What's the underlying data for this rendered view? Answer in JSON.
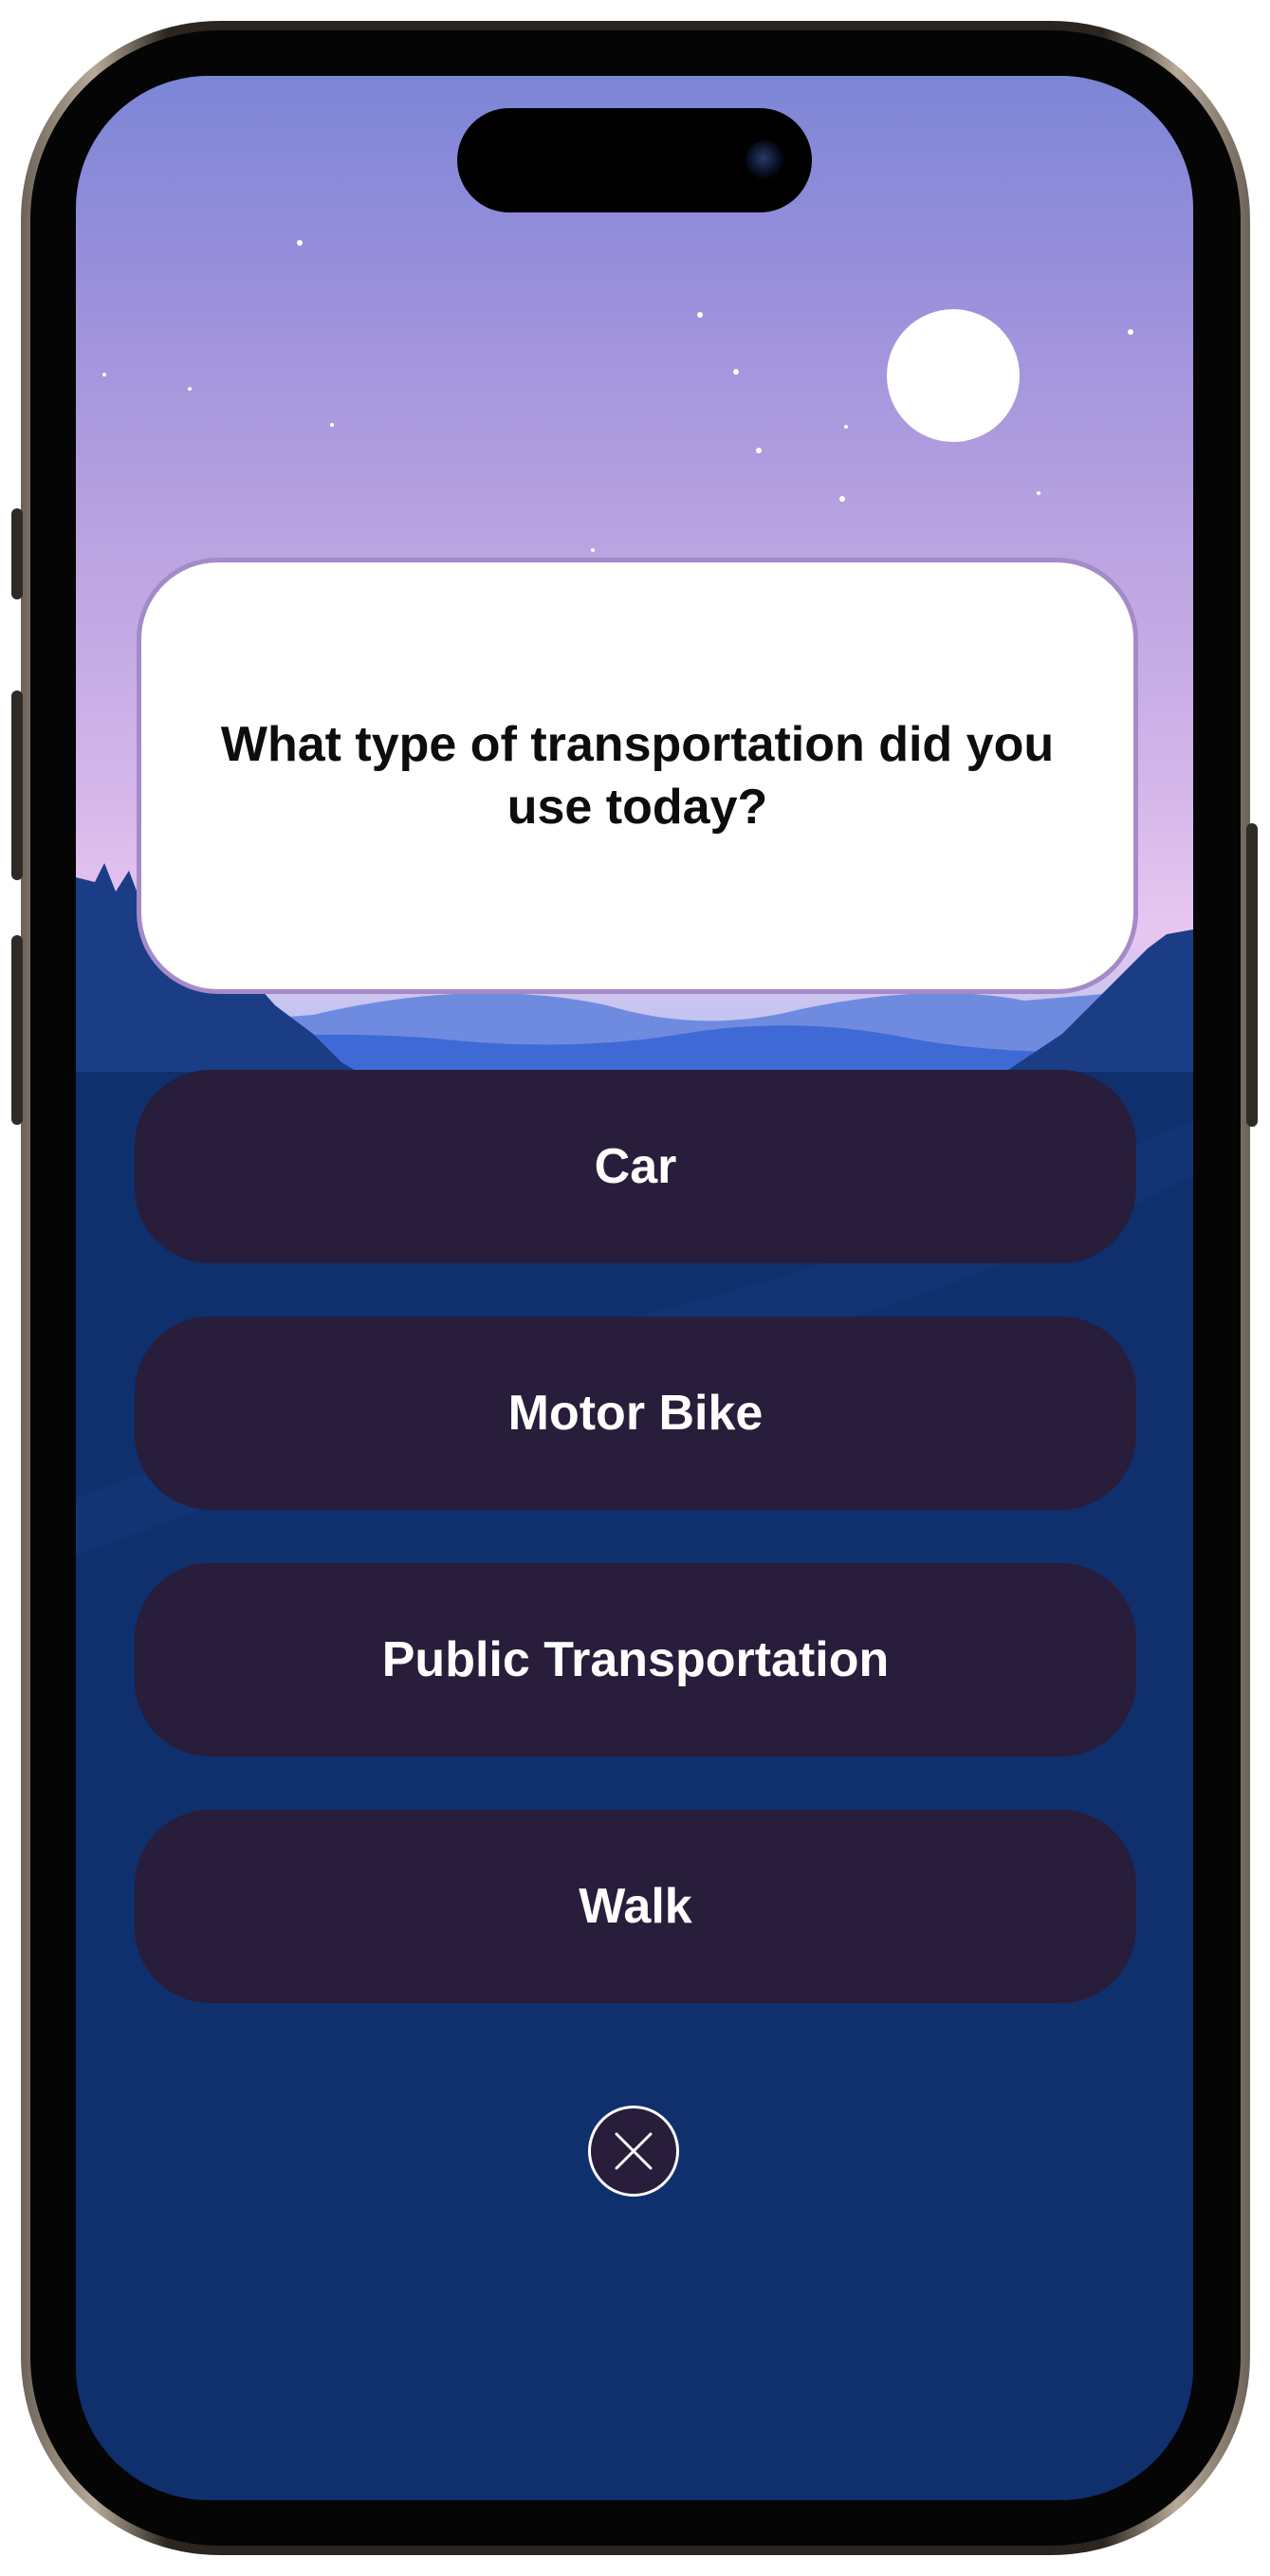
{
  "question": {
    "text": "What type of transportation did you use today?"
  },
  "options": [
    {
      "label": "Car"
    },
    {
      "label": "Motor Bike"
    },
    {
      "label": "Public Transportation"
    },
    {
      "label": "Walk"
    }
  ],
  "close": {
    "icon": "close-icon"
  },
  "colors": {
    "background_night": "#0f2f6d",
    "option_button": "#281d3a",
    "card_border": "#a48bc8",
    "sky_top": "#7c86d6",
    "sky_bottom": "#e7c7f0"
  }
}
